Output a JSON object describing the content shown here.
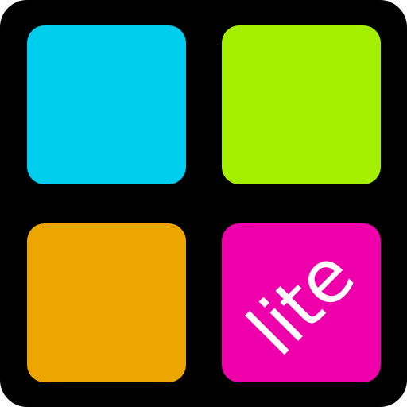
{
  "app_icon": {
    "badge_text": "lite",
    "tiles": {
      "top_left_color": "#00CCEE",
      "top_right_color": "#A4EE00",
      "bottom_left_color": "#EDA500",
      "bottom_right_color": "#EE00AA"
    },
    "background_color": "#000000",
    "badge_text_color": "#FFFFFF"
  }
}
